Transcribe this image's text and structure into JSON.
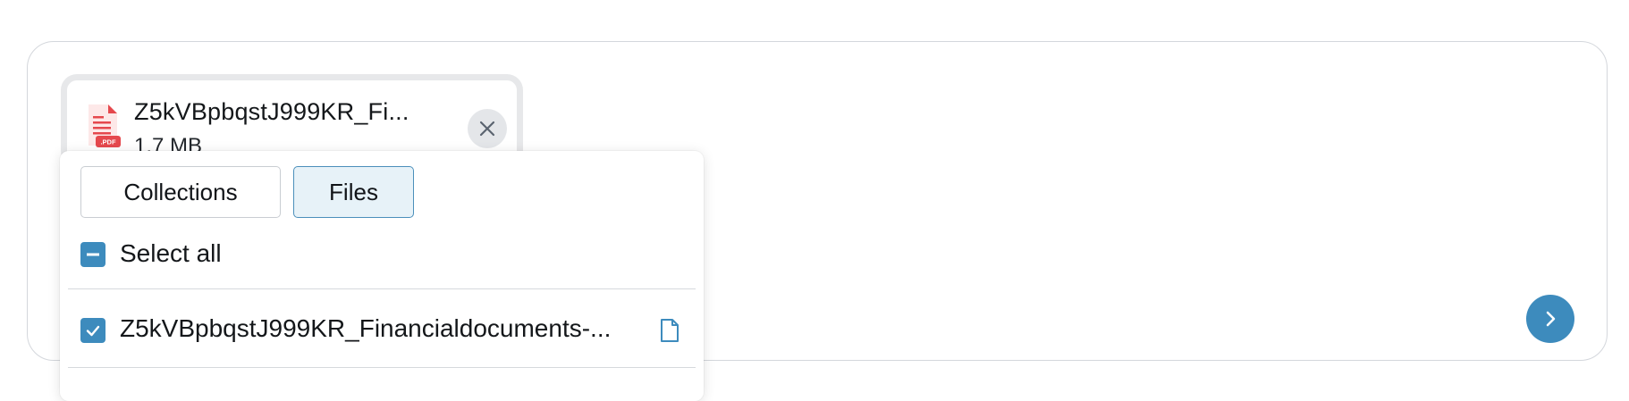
{
  "attachment": {
    "file_name": "Z5kVBpbqstJ999KR_Fi...",
    "file_size": "1.7 MB",
    "file_type_badge": ".PDF",
    "icon": "pdf-file-icon",
    "remove_icon": "close-icon"
  },
  "picker": {
    "tabs": [
      {
        "label": "Collections",
        "selected": false
      },
      {
        "label": "Files",
        "selected": true
      }
    ],
    "select_all": {
      "label": "Select all",
      "state": "indeterminate"
    },
    "files": [
      {
        "name": "Z5kVBpbqstJ999KR_Financialdocuments-...",
        "checked": true,
        "icon": "file-icon"
      }
    ]
  },
  "send": {
    "icon": "chevron-right-icon"
  },
  "colors": {
    "accent": "#3d8bbd",
    "selected_tab_bg": "#e7f2f8",
    "pdf_red": "#e5484d"
  }
}
